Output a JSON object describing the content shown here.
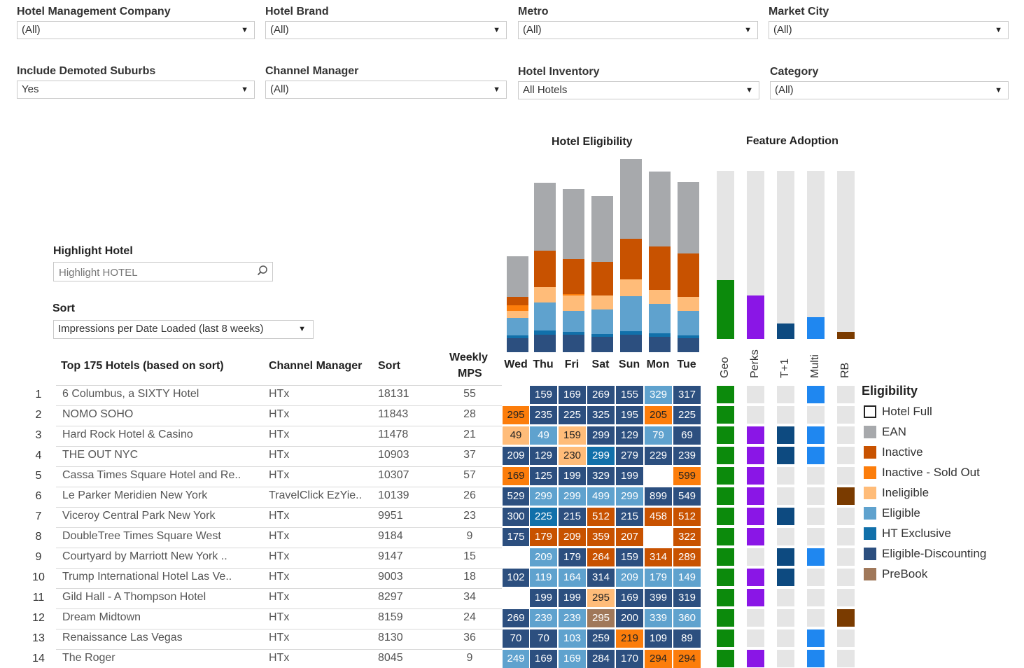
{
  "filters": [
    {
      "label": "Hotel Management Company",
      "value": "(All)"
    },
    {
      "label": "Hotel Brand",
      "value": "(All)"
    },
    {
      "label": "Metro",
      "value": "(All)"
    },
    {
      "label": "Market City",
      "value": "(All)"
    },
    {
      "label": "Include Demoted Suburbs",
      "value": "Yes"
    },
    {
      "label": "Channel Manager",
      "value": "(All)"
    },
    {
      "label": "Hotel Inventory",
      "value": "All Hotels"
    },
    {
      "label": "Category",
      "value": "(All)"
    }
  ],
  "highlight": {
    "label": "Highlight Hotel",
    "placeholder": "Highlight HOTEL"
  },
  "sort": {
    "label": "Sort",
    "value": "Impressions per Date Loaded (last 8 weeks)"
  },
  "titles": {
    "eligibility": "Hotel Eligibility",
    "feature": "Feature Adoption"
  },
  "table_headers": {
    "hotel": "Top 175 Hotels (based on sort)",
    "channel": "Channel Manager",
    "sort": "Sort",
    "mps_line1": "Weekly",
    "mps_line2": "MPS"
  },
  "days": [
    "Wed",
    "Thu",
    "Fri",
    "Sat",
    "Sun",
    "Mon",
    "Tue"
  ],
  "features": [
    "Geo",
    "Perks",
    "T+1",
    "Multi",
    "RB"
  ],
  "colors": {
    "EAN": "#a7a9ac",
    "Inactive": "#c85200",
    "InactiveSoldOut": "#fc7d0b",
    "Ineligible": "#ffbc79",
    "Eligible": "#5fa2ce",
    "HTExclusive": "#1170aa",
    "EligibleDiscounting": "#2c4f7f",
    "PreBook": "#a0785a",
    "Geo": "#0c8a0c",
    "Perks": "#8a16e6",
    "T1": "#0d4a80",
    "Multi": "#1f87f0",
    "RB": "#7a3b00",
    "empty": "#e5e5e5"
  },
  "legend": {
    "title": "Eligibility",
    "items": [
      {
        "label": "Hotel Full",
        "color": "#ffffff"
      },
      {
        "label": "EAN",
        "color": "#a7a9ac"
      },
      {
        "label": "Inactive",
        "color": "#c85200"
      },
      {
        "label": "Inactive - Sold Out",
        "color": "#fc7d0b"
      },
      {
        "label": "Ineligible",
        "color": "#ffbc79"
      },
      {
        "label": "Eligible",
        "color": "#5fa2ce"
      },
      {
        "label": "HT Exclusive",
        "color": "#1170aa"
      },
      {
        "label": "Eligible-Discounting",
        "color": "#2c4f7f"
      },
      {
        "label": "PreBook",
        "color": "#a0785a"
      }
    ]
  },
  "chart_data": [
    {
      "type": "bar",
      "title": "Hotel Eligibility",
      "stacked": true,
      "categories": [
        "Wed",
        "Thu",
        "Fri",
        "Sat",
        "Sun",
        "Mon",
        "Tue"
      ],
      "series": [
        {
          "name": "Eligible-Discounting",
          "color": "#2c4f7f",
          "values": [
            20,
            25,
            25,
            22,
            25,
            22,
            20
          ]
        },
        {
          "name": "HT Exclusive",
          "color": "#1170aa",
          "values": [
            4,
            6,
            4,
            4,
            5,
            5,
            4
          ]
        },
        {
          "name": "Eligible",
          "color": "#5fa2ce",
          "values": [
            25,
            40,
            30,
            35,
            50,
            42,
            35
          ]
        },
        {
          "name": "Ineligible",
          "color": "#ffbc79",
          "values": [
            10,
            22,
            22,
            20,
            24,
            20,
            20
          ]
        },
        {
          "name": "Inactive - Sold Out",
          "color": "#fc7d0b",
          "values": [
            8,
            0,
            2,
            0,
            0,
            0,
            0
          ]
        },
        {
          "name": "Inactive",
          "color": "#c85200",
          "values": [
            12,
            52,
            50,
            48,
            58,
            62,
            62
          ]
        },
        {
          "name": "EAN",
          "color": "#a7a9ac",
          "values": [
            58,
            97,
            100,
            94,
            114,
            107,
            102
          ]
        }
      ]
    },
    {
      "type": "bar",
      "title": "Feature Adoption",
      "categories": [
        "Geo",
        "Perks",
        "T+1",
        "Multi",
        "RB"
      ],
      "series": [
        {
          "name": "Adoption",
          "values": [
            0.35,
            0.26,
            0.09,
            0.13,
            0.04
          ]
        }
      ],
      "ylim": [
        0,
        1
      ]
    }
  ],
  "rows": [
    {
      "n": "1",
      "hotel": "6 Columbus, a SIXTY Hotel",
      "cm": "HTx",
      "sort": "18131",
      "mps": "55",
      "cells": [
        [
          "",
          ""
        ],
        [
          "159",
          "D"
        ],
        [
          "169",
          "D"
        ],
        [
          "269",
          "D"
        ],
        [
          "155",
          "D"
        ],
        [
          "329",
          "E"
        ],
        [
          "317",
          "D"
        ]
      ],
      "feat": [
        1,
        0,
        0,
        1,
        0
      ]
    },
    {
      "n": "2",
      "hotel": "NOMO SOHO",
      "cm": "HTx",
      "sort": "11843",
      "mps": "28",
      "cells": [
        [
          "295",
          "S"
        ],
        [
          "235",
          "D"
        ],
        [
          "225",
          "D"
        ],
        [
          "325",
          "D"
        ],
        [
          "195",
          "D"
        ],
        [
          "205",
          "S"
        ],
        [
          "225",
          "D"
        ]
      ],
      "feat": [
        1,
        0,
        0,
        0,
        0
      ]
    },
    {
      "n": "3",
      "hotel": "Hard Rock Hotel & Casino",
      "cm": "HTx",
      "sort": "11478",
      "mps": "21",
      "cells": [
        [
          "49",
          "N"
        ],
        [
          "49",
          "E"
        ],
        [
          "159",
          "N"
        ],
        [
          "299",
          "D"
        ],
        [
          "129",
          "D"
        ],
        [
          "79",
          "E"
        ],
        [
          "69",
          "D"
        ]
      ],
      "feat": [
        1,
        1,
        1,
        1,
        0
      ]
    },
    {
      "n": "4",
      "hotel": "THE OUT NYC",
      "cm": "HTx",
      "sort": "10903",
      "mps": "37",
      "cells": [
        [
          "209",
          "D"
        ],
        [
          "129",
          "D"
        ],
        [
          "230",
          "N"
        ],
        [
          "299",
          "H"
        ],
        [
          "279",
          "D"
        ],
        [
          "229",
          "D"
        ],
        [
          "239",
          "D"
        ]
      ],
      "feat": [
        1,
        1,
        1,
        1,
        0
      ]
    },
    {
      "n": "5",
      "hotel": "Cassa Times Square Hotel and Re..",
      "cm": "HTx",
      "sort": "10307",
      "mps": "57",
      "cells": [
        [
          "169",
          "S"
        ],
        [
          "125",
          "D"
        ],
        [
          "199",
          "D"
        ],
        [
          "329",
          "D"
        ],
        [
          "199",
          "D"
        ],
        [
          "",
          ""
        ],
        [
          "599",
          "S"
        ]
      ],
      "feat": [
        1,
        1,
        0,
        0,
        0
      ]
    },
    {
      "n": "6",
      "hotel": "Le Parker Meridien New York",
      "cm": "TravelClick EzYie..",
      "sort": "10139",
      "mps": "26",
      "cells": [
        [
          "529",
          "D"
        ],
        [
          "299",
          "E"
        ],
        [
          "299",
          "E"
        ],
        [
          "499",
          "E"
        ],
        [
          "299",
          "E"
        ],
        [
          "899",
          "D"
        ],
        [
          "549",
          "D"
        ]
      ],
      "feat": [
        1,
        1,
        0,
        0,
        1
      ]
    },
    {
      "n": "7",
      "hotel": "Viceroy Central Park New York",
      "cm": "HTx",
      "sort": "9951",
      "mps": "23",
      "cells": [
        [
          "300",
          "D"
        ],
        [
          "225",
          "H"
        ],
        [
          "215",
          "D"
        ],
        [
          "512",
          "I"
        ],
        [
          "215",
          "D"
        ],
        [
          "458",
          "I"
        ],
        [
          "512",
          "I"
        ]
      ],
      "feat": [
        1,
        1,
        1,
        0,
        0
      ]
    },
    {
      "n": "8",
      "hotel": "DoubleTree Times Square West",
      "cm": "HTx",
      "sort": "9184",
      "mps": "9",
      "cells": [
        [
          "175",
          "D"
        ],
        [
          "179",
          "I"
        ],
        [
          "209",
          "I"
        ],
        [
          "359",
          "I"
        ],
        [
          "207",
          "I"
        ],
        [
          "",
          ""
        ],
        [
          "322",
          "I"
        ]
      ],
      "feat": [
        1,
        1,
        0,
        0,
        0
      ]
    },
    {
      "n": "9",
      "hotel": "Courtyard by Marriott New York ..",
      "cm": "HTx",
      "sort": "9147",
      "mps": "15",
      "cells": [
        [
          "",
          ""
        ],
        [
          "209",
          "E"
        ],
        [
          "179",
          "D"
        ],
        [
          "264",
          "I"
        ],
        [
          "159",
          "D"
        ],
        [
          "314",
          "I"
        ],
        [
          "289",
          "I"
        ]
      ],
      "feat": [
        1,
        0,
        1,
        1,
        0
      ]
    },
    {
      "n": "10",
      "hotel": "Trump International Hotel Las Ve..",
      "cm": "HTx",
      "sort": "9003",
      "mps": "18",
      "cells": [
        [
          "102",
          "D"
        ],
        [
          "119",
          "E"
        ],
        [
          "164",
          "E"
        ],
        [
          "314",
          "D"
        ],
        [
          "209",
          "E"
        ],
        [
          "179",
          "E"
        ],
        [
          "149",
          "E"
        ]
      ],
      "feat": [
        1,
        1,
        1,
        0,
        0
      ]
    },
    {
      "n": "11",
      "hotel": "Gild Hall - A Thompson Hotel",
      "cm": "HTx",
      "sort": "8297",
      "mps": "34",
      "cells": [
        [
          "",
          ""
        ],
        [
          "199",
          "D"
        ],
        [
          "199",
          "D"
        ],
        [
          "295",
          "N"
        ],
        [
          "169",
          "D"
        ],
        [
          "399",
          "D"
        ],
        [
          "319",
          "D"
        ]
      ],
      "feat": [
        1,
        1,
        0,
        0,
        0
      ]
    },
    {
      "n": "12",
      "hotel": "Dream Midtown",
      "cm": "HTx",
      "sort": "8159",
      "mps": "24",
      "cells": [
        [
          "269",
          "D"
        ],
        [
          "239",
          "E"
        ],
        [
          "239",
          "E"
        ],
        [
          "295",
          "P"
        ],
        [
          "200",
          "D"
        ],
        [
          "339",
          "E"
        ],
        [
          "360",
          "E"
        ]
      ],
      "feat": [
        1,
        0,
        0,
        0,
        1
      ]
    },
    {
      "n": "13",
      "hotel": "Renaissance Las Vegas",
      "cm": "HTx",
      "sort": "8130",
      "mps": "36",
      "cells": [
        [
          "70",
          "D"
        ],
        [
          "70",
          "D"
        ],
        [
          "103",
          "E"
        ],
        [
          "259",
          "D"
        ],
        [
          "219",
          "S"
        ],
        [
          "109",
          "D"
        ],
        [
          "89",
          "D"
        ]
      ],
      "feat": [
        1,
        0,
        0,
        1,
        0
      ]
    },
    {
      "n": "14",
      "hotel": "The Roger",
      "cm": "HTx",
      "sort": "8045",
      "mps": "9",
      "cells": [
        [
          "249",
          "E"
        ],
        [
          "169",
          "D"
        ],
        [
          "169",
          "E"
        ],
        [
          "284",
          "D"
        ],
        [
          "170",
          "D"
        ],
        [
          "294",
          "S"
        ],
        [
          "294",
          "S"
        ]
      ],
      "feat": [
        1,
        1,
        0,
        1,
        0
      ]
    }
  ]
}
